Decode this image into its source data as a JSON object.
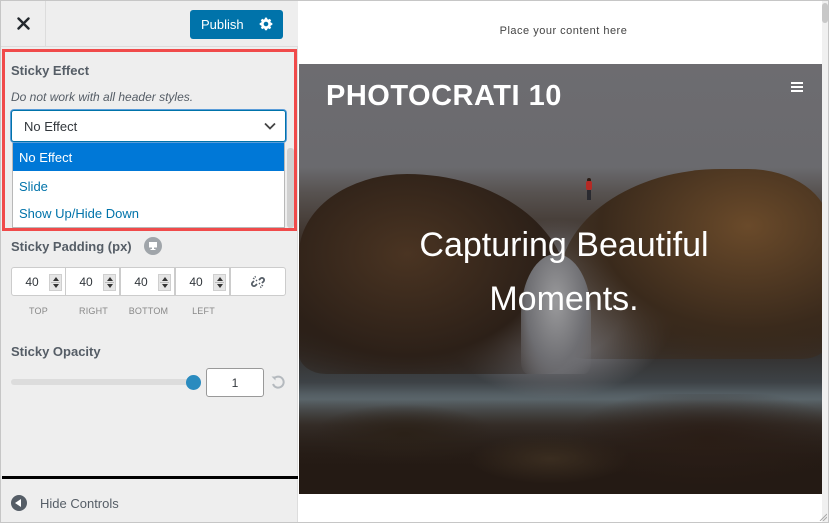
{
  "topbar": {
    "close_icon": "close-icon",
    "publish_label": "Publish",
    "settings_icon": "gear-icon"
  },
  "sticky_effect": {
    "title": "Sticky Effect",
    "description": "Do not work with all header styles.",
    "selected": "No Effect",
    "options": [
      "No Effect",
      "Slide",
      "Show Up/Hide Down"
    ],
    "highlight_color": "#f04a4a"
  },
  "sticky_padding": {
    "title": "Sticky Padding (px)",
    "device_icon": "desktop-icon",
    "fields": [
      {
        "label": "TOP",
        "value": "40"
      },
      {
        "label": "RIGHT",
        "value": "40"
      },
      {
        "label": "BOTTOM",
        "value": "40"
      },
      {
        "label": "LEFT",
        "value": "40"
      }
    ],
    "link_icon": "unlink-icon"
  },
  "sticky_opacity": {
    "title": "Sticky Opacity",
    "value": "1",
    "slider_fraction": 1.0,
    "reset_icon": "reset-icon"
  },
  "footer": {
    "hide_controls_label": "Hide Controls"
  },
  "preview": {
    "top_text": "Place your content here",
    "site_title": "PHOTOCRATI 10",
    "headline_line1": "Capturing Beautiful",
    "headline_line2": "Moments."
  },
  "colors": {
    "accent": "#0073aa",
    "selected_option": "#0078d7",
    "sidebar_bg": "#eeeeee"
  }
}
